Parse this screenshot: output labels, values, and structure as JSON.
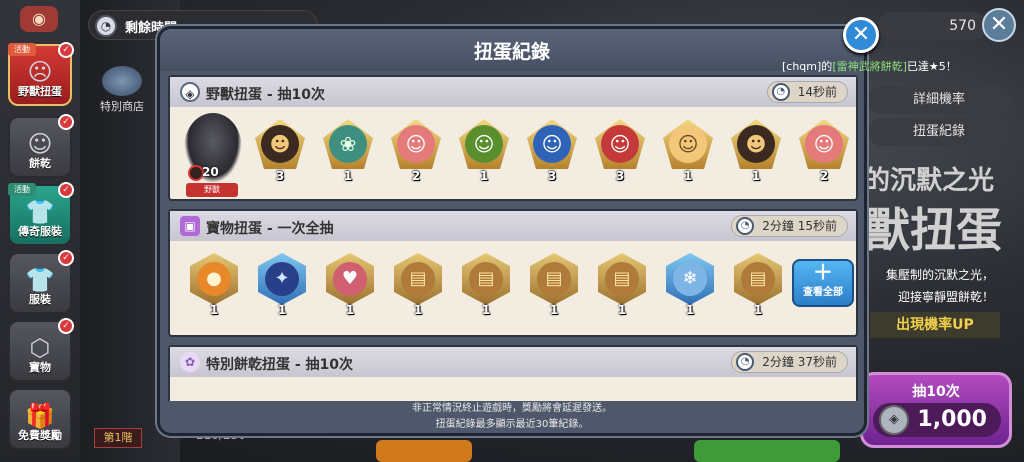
{
  "sidebar": {
    "items": [
      {
        "label": "野獸扭蛋",
        "tag": "活動",
        "badge": "✓",
        "active": true
      },
      {
        "label": "餅乾",
        "tag": "",
        "badge": "✓"
      },
      {
        "label": "傳奇服裝",
        "tag": "活動",
        "badge": "✓"
      },
      {
        "label": "服裝",
        "tag": "",
        "badge": "✓"
      },
      {
        "label": "寶物",
        "tag": "",
        "badge": "✓"
      },
      {
        "label": "免費獎勵",
        "tag": "",
        "badge": ""
      }
    ]
  },
  "background": {
    "timer_text": "剩餘時間",
    "shop_label": "特別商店",
    "currency_value": "570",
    "tab_rates": "詳細機率",
    "tab_log": "扭蛋紀錄",
    "title_line1": "的沉默之光",
    "title_line2": "獸扭蛋",
    "promo_line1": "集壓制的沉默之光，",
    "promo_line2": "迎接寧靜盟餅乾！",
    "rate_up": "出現機率UP",
    "draw_label": "抽10次",
    "draw_cost": "1,000",
    "floor_label": "第1階",
    "floor_count": "210/250"
  },
  "modal": {
    "title": "扭蛋紀錄",
    "notice_user": "[chqm]的",
    "notice_item": "[雷神武將餅乾]",
    "notice_rest": "已達★5！",
    "footer_line1": "非正常情況終止遊戲時，獎勵將會延遲發送。",
    "footer_line2": "扭蛋紀錄最多顯示最近30筆紀錄。"
  },
  "records": [
    {
      "title": "野獸扭蛋 - 抽10次",
      "time": "14秒前",
      "boss": {
        "count": "20",
        "label": "野獸"
      },
      "items": [
        {
          "qty": "3",
          "shape": "gem",
          "icon": "☻",
          "color": "#3a2a20"
        },
        {
          "qty": "1",
          "shape": "gem",
          "icon": "❀",
          "color": "#3f8f80"
        },
        {
          "qty": "2",
          "shape": "gem",
          "icon": "☺",
          "color": "#e47a7a"
        },
        {
          "qty": "1",
          "shape": "gem",
          "icon": "☺",
          "color": "#5a8f2f"
        },
        {
          "qty": "3",
          "shape": "gem",
          "icon": "☺",
          "color": "#2f63b8"
        },
        {
          "qty": "3",
          "shape": "gem",
          "icon": "☺",
          "color": "#c43a3a"
        },
        {
          "qty": "1",
          "shape": "gem",
          "icon": "☺",
          "color": "#f3c77a"
        },
        {
          "qty": "1",
          "shape": "gem",
          "icon": "☻",
          "color": "#3a2a20"
        },
        {
          "qty": "2",
          "shape": "gem",
          "icon": "☺",
          "color": "#e47a7a"
        }
      ]
    },
    {
      "title": "寶物扭蛋 - 一次全抽",
      "time": "2分鐘 15秒前",
      "view_all": "查看全部",
      "items": [
        {
          "qty": "1",
          "shape": "hex",
          "icon": "●",
          "color": "#e8882a"
        },
        {
          "qty": "1",
          "shape": "hexb",
          "icon": "✦",
          "color": "#2a3f8a"
        },
        {
          "qty": "1",
          "shape": "hex",
          "icon": "♥",
          "color": "#d06070"
        },
        {
          "qty": "1",
          "shape": "hex",
          "icon": "▤",
          "color": "#b07a3a"
        },
        {
          "qty": "1",
          "shape": "hex",
          "icon": "▤",
          "color": "#b07a3a"
        },
        {
          "qty": "1",
          "shape": "hex",
          "icon": "▤",
          "color": "#b07a3a"
        },
        {
          "qty": "1",
          "shape": "hex",
          "icon": "▤",
          "color": "#b07a3a"
        },
        {
          "qty": "1",
          "shape": "hexb",
          "icon": "❄",
          "color": "#7fb4e6"
        },
        {
          "qty": "1",
          "shape": "hex",
          "icon": "▤",
          "color": "#b07a3a"
        }
      ]
    },
    {
      "title": "特別餅乾扭蛋 - 抽10次",
      "time": "2分鐘 37秒前"
    }
  ]
}
